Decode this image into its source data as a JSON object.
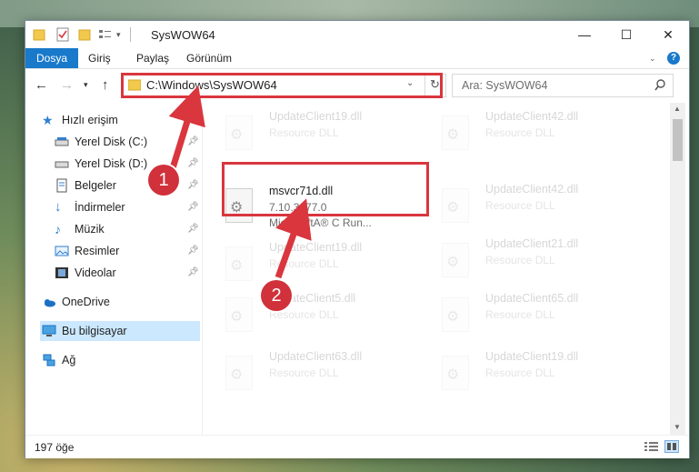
{
  "window": {
    "title": "SysWOW64",
    "minimize": "—",
    "maximize": "☐",
    "close": "✕"
  },
  "ribbon": {
    "tabs": [
      "Dosya",
      "Giriş",
      "Paylaş",
      "Görünüm"
    ],
    "help": "?"
  },
  "nav": {
    "address": "C:\\Windows\\SysWOW64",
    "search_placeholder": "Ara: SysWOW64"
  },
  "sidebar": {
    "quick_access": "Hızlı erişim",
    "items": [
      {
        "label": "Yerel Disk (C:)",
        "icon": "drive-icon"
      },
      {
        "label": "Yerel Disk (D:)",
        "icon": "drive-icon"
      },
      {
        "label": "Belgeler",
        "icon": "documents-icon"
      },
      {
        "label": "İndirmeler",
        "icon": "downloads-icon"
      },
      {
        "label": "Müzik",
        "icon": "music-icon"
      },
      {
        "label": "Resimler",
        "icon": "pictures-icon"
      },
      {
        "label": "Videolar",
        "icon": "videos-icon"
      }
    ],
    "onedrive": "OneDrive",
    "this_pc": "Bu bilgisayar",
    "network": "Ağ"
  },
  "files": {
    "highlighted": {
      "name": "msvcr71d.dll",
      "version": "7.10.3077.0",
      "company": "MicrosoftA® C Run..."
    },
    "faded_left": [
      {
        "name": "UpdateClient19.dll",
        "desc": "Resource DLL"
      },
      {
        "name": "UpdateClient42.dll",
        "desc": "Resource DLL"
      },
      {
        "name": "UpdateClient19.dll",
        "desc": "Resource DLL"
      },
      {
        "name": "UpdateClient5.dll",
        "desc": "Resource DLL"
      },
      {
        "name": "UpdateClient63.dll",
        "desc": "Resource DLL"
      }
    ],
    "faded_right": [
      {
        "name": "UpdateClient42.dll",
        "desc": "Resource DLL"
      },
      {
        "name": "UpdateClient42.dll",
        "desc": "Resource DLL"
      },
      {
        "name": "UpdateClient21.dll",
        "desc": "Resource DLL"
      },
      {
        "name": "UpdateClient65.dll",
        "desc": "Resource DLL"
      },
      {
        "name": "UpdateClient19.dll",
        "desc": "Resource DLL"
      }
    ]
  },
  "status": {
    "count": "197 öğe"
  },
  "annotations": {
    "step1": "1",
    "step2": "2",
    "color": "#d9363e"
  }
}
